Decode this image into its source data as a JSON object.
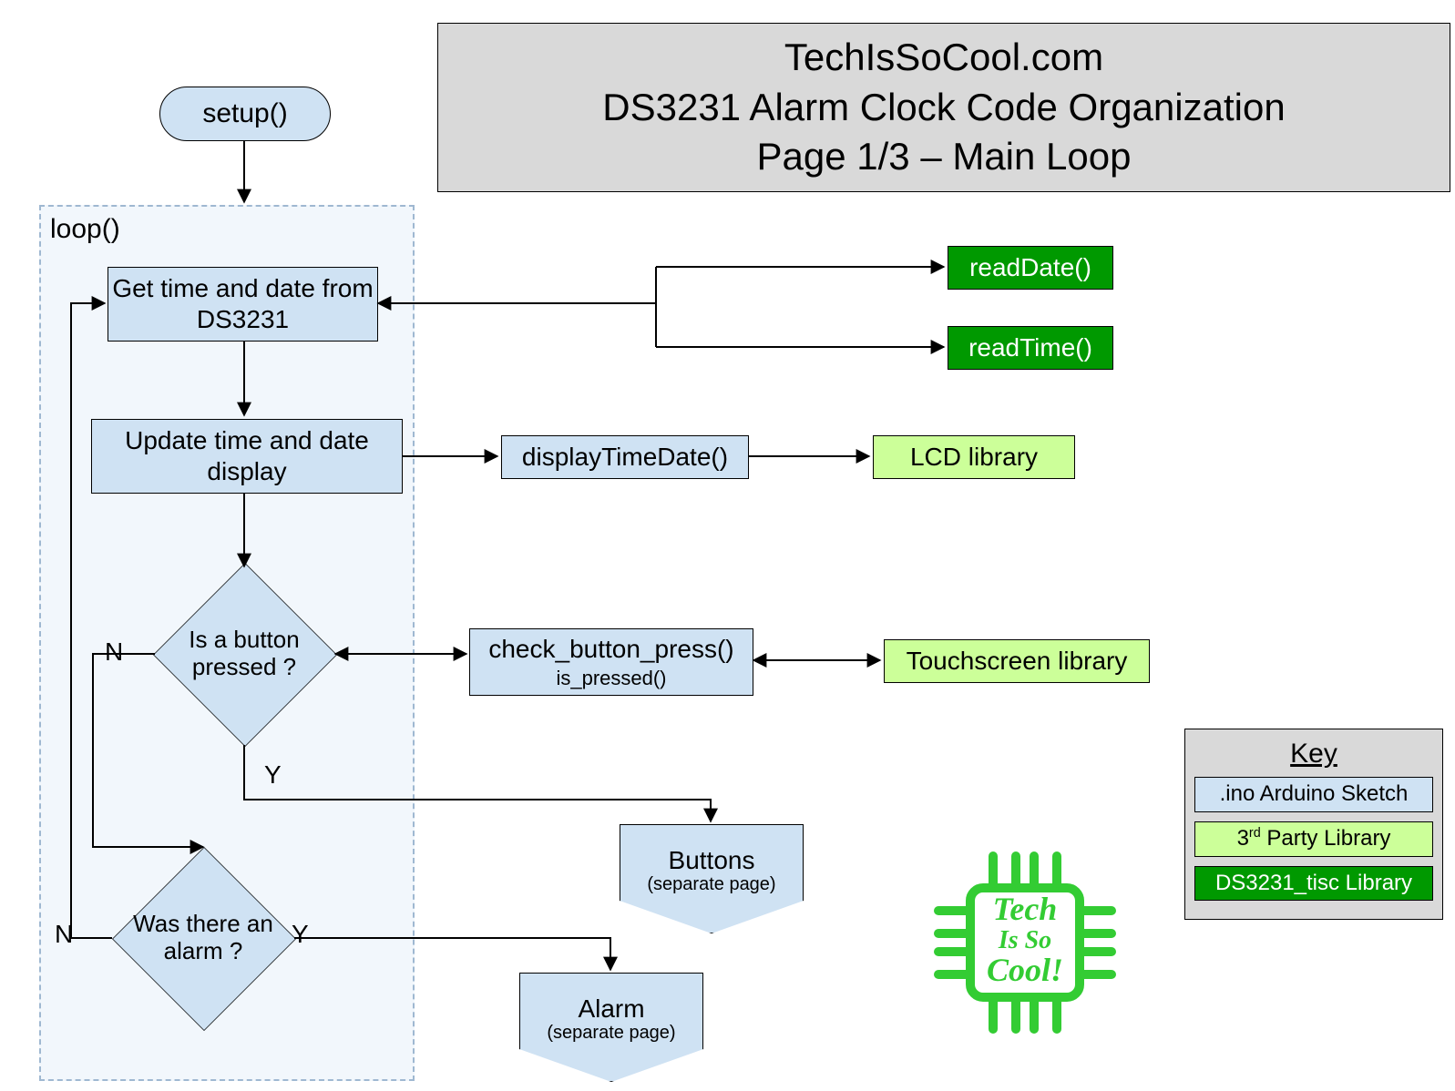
{
  "title": {
    "line1": "TechIsSoCool.com",
    "line2": "DS3231 Alarm Clock Code Organization",
    "line3": "Page 1/3 – Main Loop"
  },
  "nodes": {
    "setup": "setup()",
    "loop_label": "loop()",
    "get_time": "Get time and date from DS3231",
    "update_display": "Update time and date display",
    "is_button": "Is a button pressed ?",
    "was_alarm": "Was there an alarm ?",
    "display_time_date": "displayTimeDate()",
    "check_button": "check_button_press()",
    "is_pressed": "is_pressed()",
    "read_date": "readDate()",
    "read_time": "readTime()",
    "lcd_lib": "LCD library",
    "touch_lib": "Touchscreen library",
    "buttons_page": "Buttons",
    "buttons_sub": "(separate page)",
    "alarm_page": "Alarm",
    "alarm_sub": "(separate page)"
  },
  "labels": {
    "N": "N",
    "Y": "Y"
  },
  "key": {
    "title": "Key",
    "ino": ".ino Arduino Sketch",
    "thirdparty_pre": "3",
    "thirdparty_sup": "rd",
    "thirdparty_post": " Party Library",
    "ds3231": "DS3231_tisc Library"
  },
  "logo": {
    "line1": "Tech",
    "line2": "Is So",
    "line3": "Cool!"
  },
  "chart_data": {
    "type": "flowchart",
    "title": "DS3231 Alarm Clock Code Organization — Page 1/3 Main Loop",
    "legend": [
      {
        "color": "#cfe2f3",
        "meaning": ".ino Arduino Sketch"
      },
      {
        "color": "#ccff99",
        "meaning": "3rd Party Library"
      },
      {
        "color": "#009900",
        "meaning": "DS3231_tisc Library"
      }
    ],
    "nodes": [
      {
        "id": "setup",
        "shape": "terminator",
        "label": "setup()",
        "category": "ino"
      },
      {
        "id": "loop",
        "shape": "container",
        "label": "loop()",
        "category": "ino"
      },
      {
        "id": "get_time",
        "shape": "process",
        "label": "Get time and date from DS3231",
        "category": "ino",
        "parent": "loop"
      },
      {
        "id": "update_display",
        "shape": "process",
        "label": "Update time and date display",
        "category": "ino",
        "parent": "loop"
      },
      {
        "id": "is_button",
        "shape": "decision",
        "label": "Is a button pressed?",
        "category": "ino",
        "parent": "loop"
      },
      {
        "id": "was_alarm",
        "shape": "decision",
        "label": "Was there an alarm?",
        "category": "ino",
        "parent": "loop"
      },
      {
        "id": "display_time_date",
        "shape": "process",
        "label": "displayTimeDate()",
        "category": "ino"
      },
      {
        "id": "check_button",
        "shape": "process",
        "label": "check_button_press() / is_pressed()",
        "category": "ino"
      },
      {
        "id": "read_date",
        "shape": "process",
        "label": "readDate()",
        "category": "ds3231_tisc"
      },
      {
        "id": "read_time",
        "shape": "process",
        "label": "readTime()",
        "category": "ds3231_tisc"
      },
      {
        "id": "lcd_lib",
        "shape": "process",
        "label": "LCD library",
        "category": "third_party"
      },
      {
        "id": "touch_lib",
        "shape": "process",
        "label": "Touchscreen library",
        "category": "third_party"
      },
      {
        "id": "buttons_page",
        "shape": "offpage",
        "label": "Buttons (separate page)",
        "category": "ino"
      },
      {
        "id": "alarm_page",
        "shape": "offpage",
        "label": "Alarm (separate page)",
        "category": "ino"
      }
    ],
    "edges": [
      {
        "from": "setup",
        "to": "loop",
        "dir": "forward"
      },
      {
        "from": "get_time",
        "to": "update_display",
        "dir": "forward"
      },
      {
        "from": "update_display",
        "to": "is_button",
        "dir": "forward"
      },
      {
        "from": "is_button",
        "to": "was_alarm",
        "label": "N",
        "dir": "forward"
      },
      {
        "from": "is_button",
        "to": "buttons_page",
        "label": "Y",
        "dir": "forward"
      },
      {
        "from": "was_alarm",
        "to": "get_time",
        "label": "N",
        "dir": "forward",
        "note": "loop back"
      },
      {
        "from": "was_alarm",
        "to": "alarm_page",
        "label": "Y",
        "dir": "forward"
      },
      {
        "from": "get_time",
        "to": "read_date",
        "dir": "both",
        "via": "branch"
      },
      {
        "from": "get_time",
        "to": "read_time",
        "dir": "both",
        "via": "branch"
      },
      {
        "from": "update_display",
        "to": "display_time_date",
        "dir": "forward"
      },
      {
        "from": "display_time_date",
        "to": "lcd_lib",
        "dir": "forward"
      },
      {
        "from": "is_button",
        "to": "check_button",
        "dir": "both"
      },
      {
        "from": "check_button",
        "to": "touch_lib",
        "dir": "both"
      }
    ]
  }
}
